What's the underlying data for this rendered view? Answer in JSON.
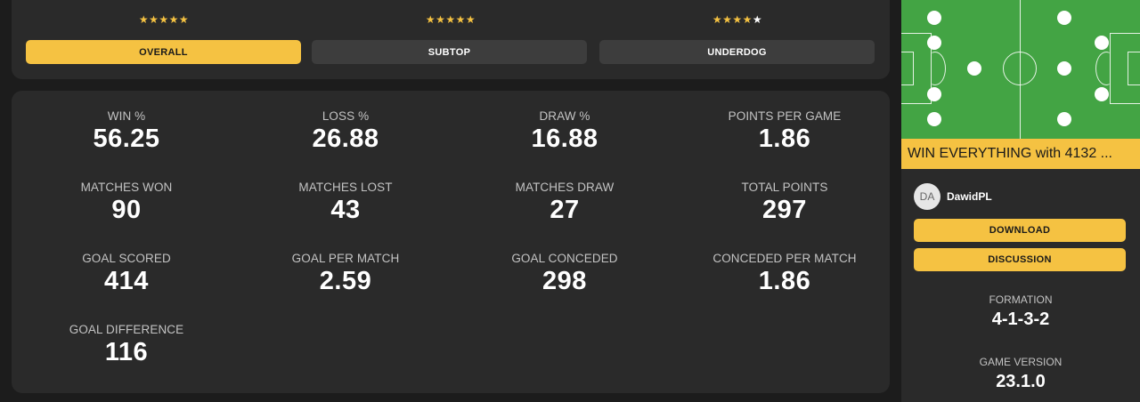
{
  "tabs": [
    {
      "label": "OVERALL",
      "stars_on": "★★★★★",
      "stars_off": ""
    },
    {
      "label": "SUBTOP",
      "stars_on": "★★★★★",
      "stars_off": ""
    },
    {
      "label": "UNDERDOG",
      "stars_on": "★★★★",
      "stars_off": "★"
    }
  ],
  "active_tab": "OVERALL",
  "stats": [
    {
      "label": "WIN %",
      "value": "56.25"
    },
    {
      "label": "LOSS %",
      "value": "26.88"
    },
    {
      "label": "DRAW %",
      "value": "16.88"
    },
    {
      "label": "POINTS PER GAME",
      "value": "1.86"
    },
    {
      "label": "MATCHES WON",
      "value": "90"
    },
    {
      "label": "MATCHES LOST",
      "value": "43"
    },
    {
      "label": "MATCHES DRAW",
      "value": "27"
    },
    {
      "label": "TOTAL POINTS",
      "value": "297"
    },
    {
      "label": "GOAL SCORED",
      "value": "414"
    },
    {
      "label": "GOAL PER MATCH",
      "value": "2.59"
    },
    {
      "label": "GOAL CONCEDED",
      "value": "298"
    },
    {
      "label": "CONCEDED PER MATCH",
      "value": "1.86"
    },
    {
      "label": "GOAL DIFFERENCE",
      "value": "116"
    }
  ],
  "tactic": {
    "title": "WIN EVERYTHING with 4132 ...",
    "author_initials": "DA",
    "author_name": "DawidPL",
    "download_label": "DOWNLOAD",
    "discussion_label": "DISCUSSION",
    "formation_label": "FORMATION",
    "formation_value": "4-1-3-2",
    "version_label": "GAME VERSION",
    "version_value": "23.1.0"
  },
  "colors": {
    "accent": "#f5c242",
    "pitch": "#43a444",
    "card": "#2a2a2a",
    "background": "#1c1c1c"
  }
}
